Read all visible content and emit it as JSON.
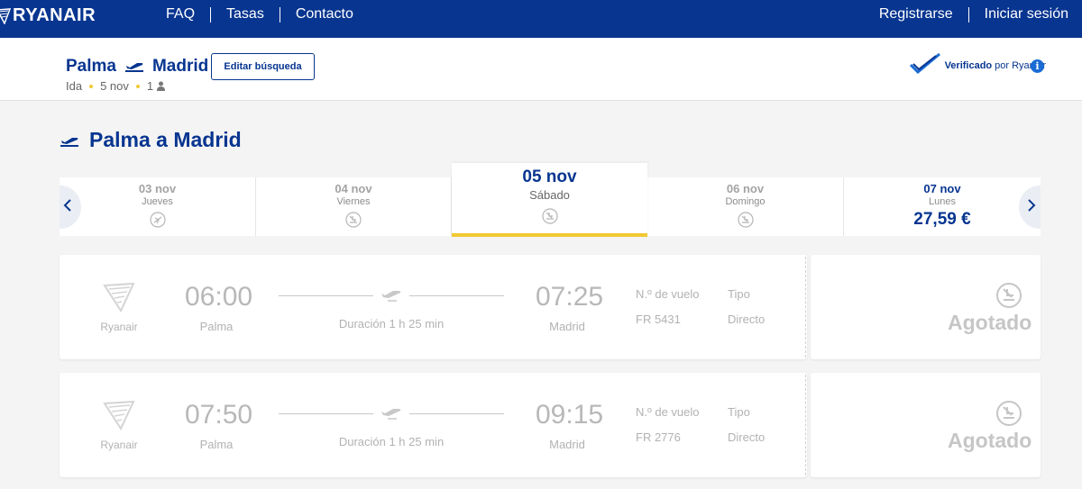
{
  "header": {
    "logo_text": "RYANAIR",
    "nav": [
      "FAQ",
      "Tasas",
      "Contacto"
    ],
    "register": "Registrarse",
    "login": "Iniciar sesión",
    "colors": {
      "primary": "#073590",
      "accent": "#f1c933"
    }
  },
  "search": {
    "origin": "Palma",
    "destination": "Madrid",
    "trip_type": "Ida",
    "date": "5 nov",
    "passengers": "1",
    "edit_button": "Editar búsqueda",
    "verified_strong": "Verificado",
    "verified_rest": "por Ryanair",
    "info_icon": "i"
  },
  "section": {
    "title": "Palma a Madrid"
  },
  "dates": [
    {
      "date": "03 nov",
      "weekday": "Jueves",
      "status": "no-flights"
    },
    {
      "date": "04 nov",
      "weekday": "Viernes",
      "status": "sold-out"
    },
    {
      "date": "05 nov",
      "weekday": "Sábado",
      "status": "sold-out",
      "selected": true
    },
    {
      "date": "06 nov",
      "weekday": "Domingo",
      "status": "sold-out"
    },
    {
      "date": "07 nov",
      "weekday": "Lunes",
      "status": "available",
      "price": "27,59 €"
    }
  ],
  "flights": [
    {
      "airline": "Ryanair",
      "departure_time": "06:00",
      "departure_city": "Palma",
      "duration": "Duración 1 h 25 min",
      "arrival_time": "07:25",
      "arrival_city": "Madrid",
      "flight_number_label": "N.º de vuelo",
      "flight_number": "FR 5431",
      "type_label": "Tipo",
      "type": "Directo",
      "status": "Agotado"
    },
    {
      "airline": "Ryanair",
      "departure_time": "07:50",
      "departure_city": "Palma",
      "duration": "Duración 1 h 25 min",
      "arrival_time": "09:15",
      "arrival_city": "Madrid",
      "flight_number_label": "N.º de vuelo",
      "flight_number": "FR 2776",
      "type_label": "Tipo",
      "type": "Directo",
      "status": "Agotado"
    }
  ],
  "icons": {
    "logo": "ryanair-harp-icon",
    "route": "plane-icon",
    "person": "person-icon",
    "verified": "checkmark-icon",
    "date_nav": [
      "chevron-left-icon",
      "chevron-right-icon"
    ],
    "no_flights": "plane-off-icon",
    "sold_out": "plane-landing-icon"
  }
}
